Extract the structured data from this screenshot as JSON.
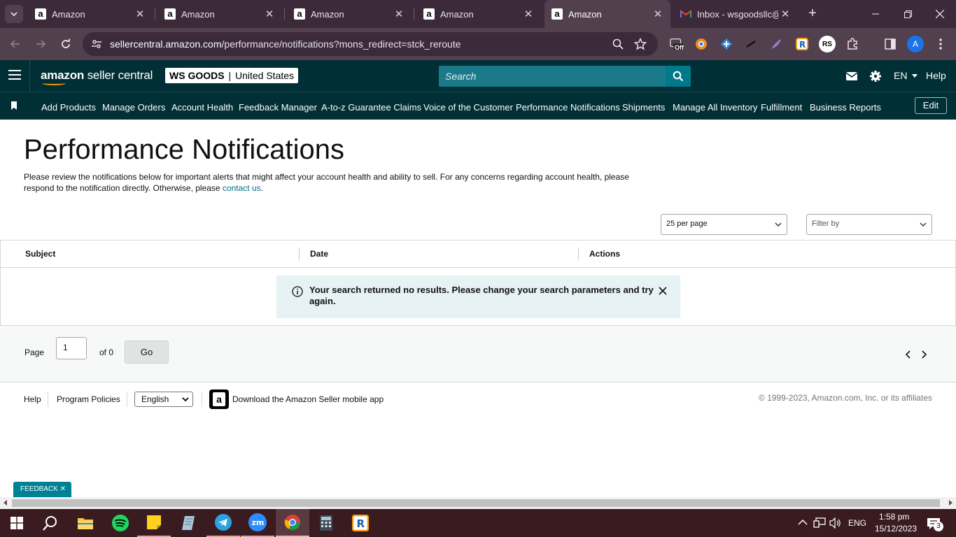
{
  "browser": {
    "tabs": [
      {
        "title": "Amazon",
        "active": false
      },
      {
        "title": "Amazon",
        "active": false
      },
      {
        "title": "Amazon",
        "active": false
      },
      {
        "title": "Amazon",
        "active": false
      },
      {
        "title": "Amazon",
        "active": true
      },
      {
        "title": "Inbox - wsgoodsllc@",
        "active": false
      }
    ],
    "url_domain": "sellercentral.amazon.com",
    "url_path": "/performance/notifications?mons_redirect=stck_reroute",
    "extension_badge": "Off",
    "profile_initial": "A"
  },
  "header": {
    "logo_bold": "amazon",
    "logo_rest": " seller central",
    "store_name": "WS GOODS",
    "store_divider": "|",
    "store_region": "United States",
    "search_placeholder": "Search",
    "language": "EN",
    "help": "Help"
  },
  "nav": {
    "links": [
      "Add Products",
      "Manage Orders",
      "Account Health",
      "Feedback Manager",
      "A-to-z Guarantee Claims",
      "Voice of the Customer",
      "Performance Notifications",
      "Shipments",
      "Manage All Inventory",
      "Fulfillment",
      "Business Reports"
    ],
    "edit": "Edit"
  },
  "main": {
    "title": "Performance Notifications",
    "intro": "Please review the notifications below for important alerts that might affect your account health and ability to sell. For any concerns regarding account health, please respond to the notification directly. Otherwise, please ",
    "intro_link": "contact us",
    "intro_end": ".",
    "per_page": "25 per page",
    "filter": "Filter by",
    "columns": [
      "Subject",
      "Date",
      "Actions"
    ],
    "no_results": "Your search returned no results. Please change your search parameters and try again.",
    "pager": {
      "label": "Page",
      "value": "1",
      "of": "of 0",
      "go": "Go"
    }
  },
  "footer": {
    "help": "Help",
    "policies": "Program Policies",
    "language": "English",
    "app": "Download the Amazon Seller mobile app",
    "copyright": "© 1999-2023, Amazon.com, Inc. or its affiliates"
  },
  "feedback": "FEEDBACK ✕",
  "taskbar": {
    "lang": "ENG",
    "time": "1:58 pm",
    "date": "15/12/2023",
    "notifications": "3"
  }
}
